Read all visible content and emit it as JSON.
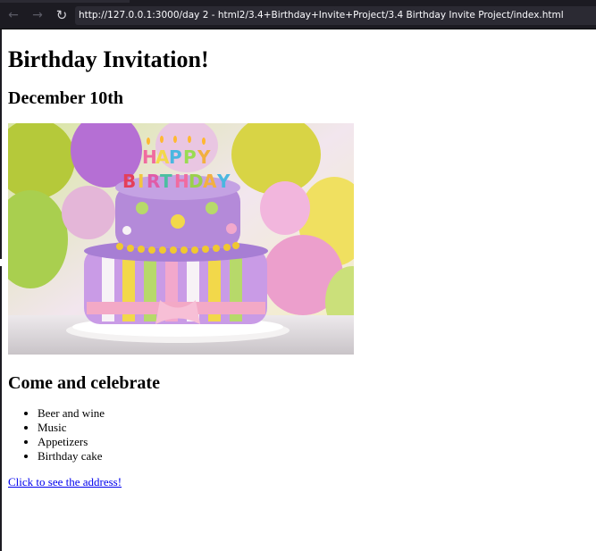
{
  "browser": {
    "url": "http://127.0.0.1:3000/day 2 - html2/3.4+Birthday+Invite+Project/3.4 Birthday Invite Project/index.html",
    "back_icon": "arrow-left-icon",
    "forward_icon": "arrow-right-icon",
    "reload_icon": "reload-icon"
  },
  "page": {
    "title": "Birthday Invitation!",
    "date": "December 10th",
    "image": {
      "subject": "birthday-cake-photo",
      "candle_text": "HAPPY BIRTHDAY"
    },
    "subheading": "Come and celebrate",
    "items": [
      "Beer and wine",
      "Music",
      "Appetizers",
      "Birthday cake"
    ],
    "link": "Click to see the address!"
  },
  "colors": {
    "browser_chrome": "#1c1b22",
    "url_field": "#2b2a33",
    "link": "#0000ee"
  }
}
